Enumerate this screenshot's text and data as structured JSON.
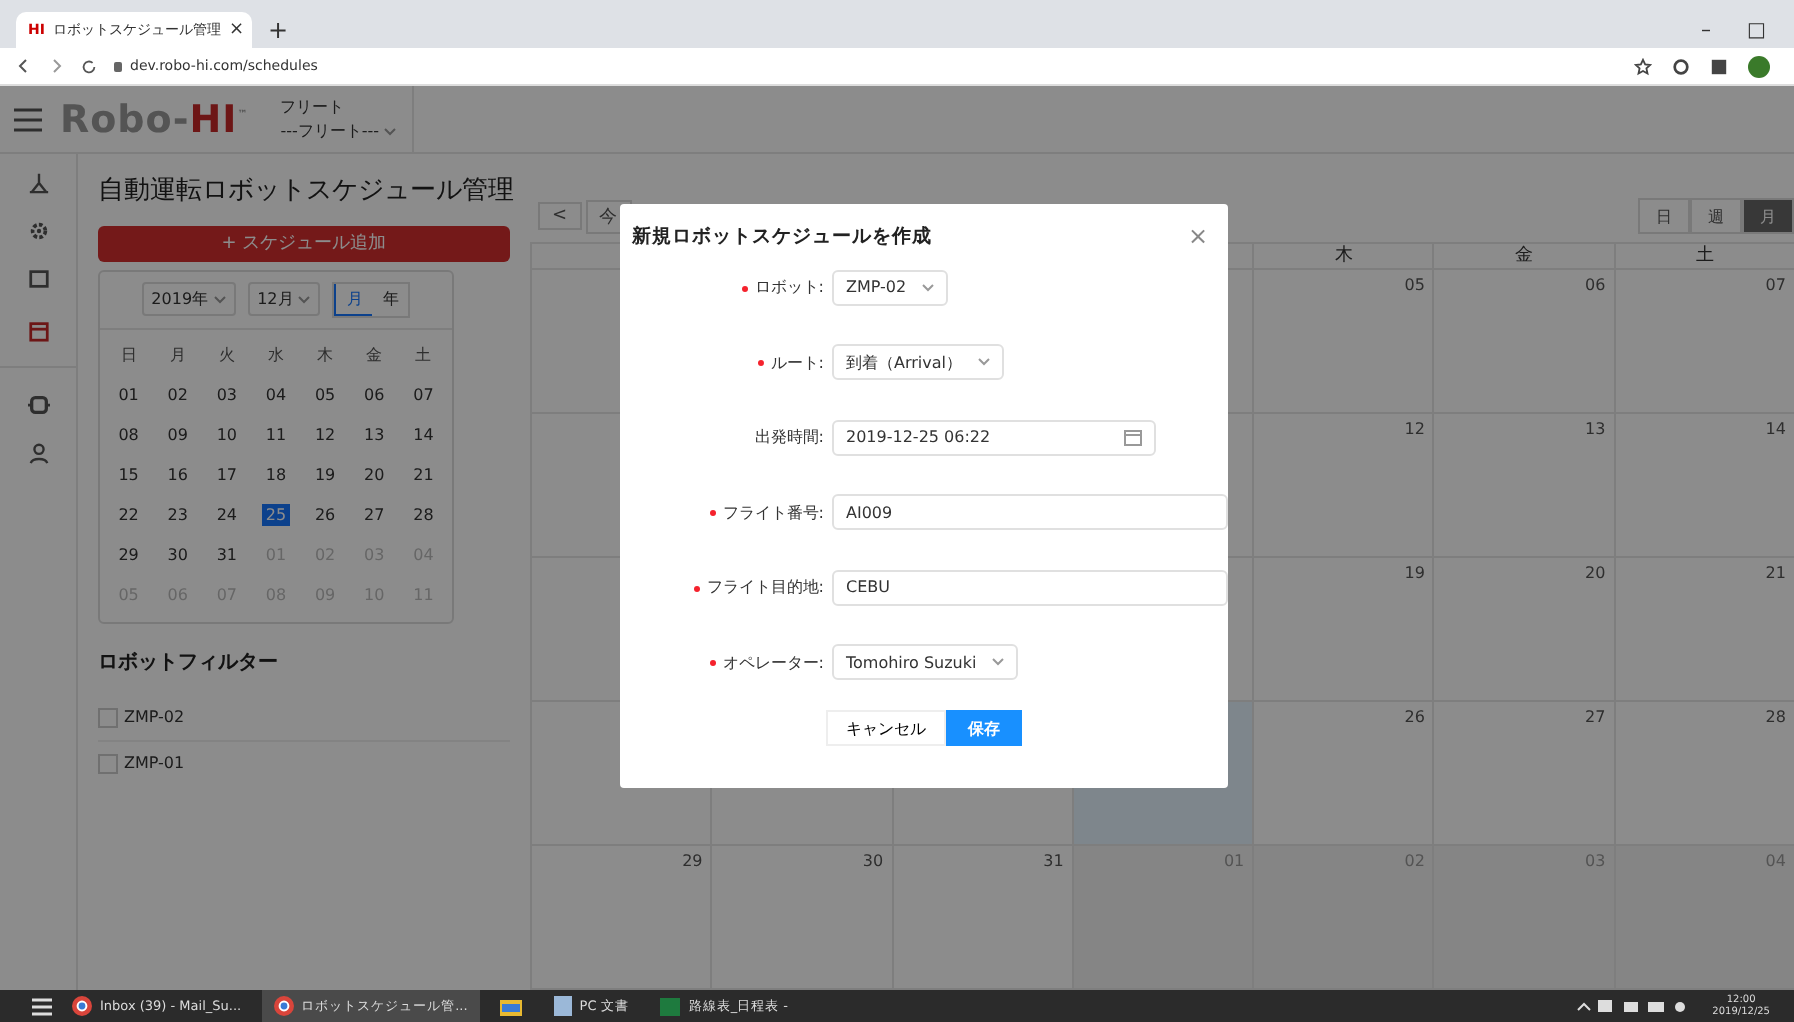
{
  "browser": {
    "favicon": "HI",
    "tab_title": "ロボットスケジュール管理",
    "tab_close": "×",
    "new_tab": "+",
    "url": "dev.robo-hi.com/schedules",
    "window_controls": [
      "–",
      "□"
    ]
  },
  "header": {
    "logo_main": "Robo-",
    "logo_accent": "HI",
    "logo_mark": "™",
    "fleet_label": "フリート",
    "fleet_select": "---フリート---"
  },
  "sidebar": {
    "items": [
      {
        "kind": "user",
        "selected": false
      },
      {
        "kind": "gear",
        "selected": false
      },
      {
        "kind": "box",
        "selected": false
      },
      {
        "kind": "calendar",
        "selected": true
      },
      {
        "kind": "robot",
        "selected": false
      },
      {
        "kind": "person",
        "selected": false
      }
    ]
  },
  "page_title": "自動運転ロボットスケジュール管理",
  "add_button": "+ スケジュール追加",
  "mini_calendar": {
    "year": "2019年",
    "month": "12月",
    "modes": [
      {
        "label": "月",
        "selected": true
      },
      {
        "label": "年",
        "selected": false
      }
    ],
    "weekdays": [
      "日",
      "月",
      "火",
      "水",
      "木",
      "金",
      "土"
    ],
    "weeks": [
      [
        {
          "d": "01",
          "other": false,
          "selected": false
        },
        {
          "d": "02",
          "other": false,
          "selected": false
        },
        {
          "d": "03",
          "other": false,
          "selected": false
        },
        {
          "d": "04",
          "other": false,
          "selected": false
        },
        {
          "d": "05",
          "other": false,
          "selected": false
        },
        {
          "d": "06",
          "other": false,
          "selected": false
        },
        {
          "d": "07",
          "other": false,
          "selected": false
        }
      ],
      [
        {
          "d": "08",
          "other": false,
          "selected": false
        },
        {
          "d": "09",
          "other": false,
          "selected": false
        },
        {
          "d": "10",
          "other": false,
          "selected": false
        },
        {
          "d": "11",
          "other": false,
          "selected": false
        },
        {
          "d": "12",
          "other": false,
          "selected": false
        },
        {
          "d": "13",
          "other": false,
          "selected": false
        },
        {
          "d": "14",
          "other": false,
          "selected": false
        }
      ],
      [
        {
          "d": "15",
          "other": false,
          "selected": false
        },
        {
          "d": "16",
          "other": false,
          "selected": false
        },
        {
          "d": "17",
          "other": false,
          "selected": false
        },
        {
          "d": "18",
          "other": false,
          "selected": false
        },
        {
          "d": "19",
          "other": false,
          "selected": false
        },
        {
          "d": "20",
          "other": false,
          "selected": false
        },
        {
          "d": "21",
          "other": false,
          "selected": false
        }
      ],
      [
        {
          "d": "22",
          "other": false,
          "selected": false
        },
        {
          "d": "23",
          "other": false,
          "selected": false
        },
        {
          "d": "24",
          "other": false,
          "selected": false
        },
        {
          "d": "25",
          "other": false,
          "selected": true
        },
        {
          "d": "26",
          "other": false,
          "selected": false
        },
        {
          "d": "27",
          "other": false,
          "selected": false
        },
        {
          "d": "28",
          "other": false,
          "selected": false
        }
      ],
      [
        {
          "d": "29",
          "other": false,
          "selected": false
        },
        {
          "d": "30",
          "other": false,
          "selected": false
        },
        {
          "d": "31",
          "other": false,
          "selected": false
        },
        {
          "d": "01",
          "other": true,
          "selected": false
        },
        {
          "d": "02",
          "other": true,
          "selected": false
        },
        {
          "d": "03",
          "other": true,
          "selected": false
        },
        {
          "d": "04",
          "other": true,
          "selected": false
        }
      ],
      [
        {
          "d": "05",
          "other": true,
          "selected": false
        },
        {
          "d": "06",
          "other": true,
          "selected": false
        },
        {
          "d": "07",
          "other": true,
          "selected": false
        },
        {
          "d": "08",
          "other": true,
          "selected": false
        },
        {
          "d": "09",
          "other": true,
          "selected": false
        },
        {
          "d": "10",
          "other": true,
          "selected": false
        },
        {
          "d": "11",
          "other": true,
          "selected": false
        }
      ]
    ]
  },
  "robot_filter": {
    "title": "ロボットフィルター",
    "items": [
      {
        "label": "ZMP-02",
        "checked": false
      },
      {
        "label": "ZMP-01",
        "checked": false
      }
    ]
  },
  "calendar": {
    "prev": "<",
    "today": "今",
    "views": [
      {
        "label": "日",
        "selected": false
      },
      {
        "label": "週",
        "selected": false
      },
      {
        "label": "月",
        "selected": true
      }
    ],
    "weekdays": [
      "木",
      "金",
      "土"
    ],
    "weeks": [
      [
        {
          "d": "05",
          "other": false,
          "today": false
        },
        {
          "d": "06",
          "other": false,
          "today": false
        },
        {
          "d": "07",
          "other": false,
          "today": false
        }
      ],
      [
        {
          "d": "12",
          "other": false,
          "today": false
        },
        {
          "d": "13",
          "other": false,
          "today": false
        },
        {
          "d": "14",
          "other": false,
          "today": false
        }
      ],
      [
        {
          "d": "19",
          "other": false,
          "today": false
        },
        {
          "d": "20",
          "other": false,
          "today": false
        },
        {
          "d": "21",
          "other": false,
          "today": false
        }
      ],
      [
        {
          "other": false,
          "today": true
        },
        {
          "d": "26",
          "other": false,
          "today": false
        },
        {
          "d": "27",
          "other": false,
          "today": false
        },
        {
          "d": "28",
          "other": false,
          "today": false
        }
      ],
      [
        {
          "d": "29",
          "other": false,
          "today": false
        },
        {
          "d": "30",
          "other": false,
          "today": false
        },
        {
          "d": "31",
          "other": false,
          "today": false
        },
        {
          "d": "01",
          "other": true,
          "today": false
        },
        {
          "d": "02",
          "other": true,
          "today": false
        },
        {
          "d": "03",
          "other": true,
          "today": false
        },
        {
          "d": "04",
          "other": true,
          "today": false
        }
      ]
    ]
  },
  "dialog": {
    "title": "新規ロボットスケジュールを作成",
    "close": "×",
    "fields": [
      {
        "label": "ロボット:",
        "required": true,
        "kind": "select",
        "value": "ZMP-02"
      },
      {
        "label": "ルート:",
        "required": true,
        "kind": "select",
        "value": "到着（Arrival）"
      },
      {
        "label": "出発時間:",
        "required": false,
        "kind": "date",
        "value": "2019-12-25 06:22"
      },
      {
        "label": "フライト番号:",
        "required": true,
        "kind": "text",
        "value": "AI009"
      },
      {
        "label": "フライト目的地:",
        "required": true,
        "kind": "text",
        "value": "CEBU"
      },
      {
        "label": "オペレーター:",
        "required": true,
        "kind": "select",
        "value": "Tomohiro Suzuki"
      }
    ],
    "cancel": "キャンセル",
    "save": "保存"
  },
  "taskbar": {
    "items": [
      {
        "kind": "browser",
        "label": "Inbox (39) - Mail_Su...",
        "selected": false
      },
      {
        "kind": "browser",
        "label": "ロボットスケジュール管...",
        "selected": true
      },
      {
        "kind": "folder",
        "selected": false
      },
      {
        "kind": "doc",
        "label": "PC 文書",
        "selected": false
      },
      {
        "kind": "excel",
        "label": "路線表_日程表 -",
        "selected": false
      }
    ],
    "clock_time": "12:00",
    "clock_date": "2019/12/25"
  }
}
